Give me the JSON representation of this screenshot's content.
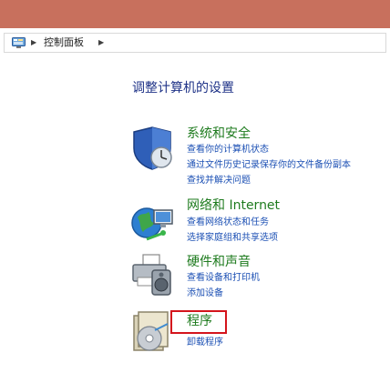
{
  "address_bar": {
    "breadcrumb": "控制面板",
    "icon": "control-panel-icon"
  },
  "page_title": "调整计算机的设置",
  "categories": [
    {
      "title": "系统和安全",
      "icon": "shield-clock-icon",
      "links": [
        "查看你的计算机状态",
        "通过文件历史记录保存你的文件备份副本",
        "查找并解决问题"
      ]
    },
    {
      "title": "网络和 Internet",
      "icon": "globe-network-icon",
      "links": [
        "查看网络状态和任务",
        "选择家庭组和共享选项"
      ]
    },
    {
      "title": "硬件和声音",
      "icon": "printer-speaker-icon",
      "links": [
        "查看设备和打印机",
        "添加设备"
      ]
    },
    {
      "title": "程序",
      "icon": "programs-disc-icon",
      "highlighted": true,
      "links": [
        "卸载程序"
      ]
    }
  ],
  "colors": {
    "title_bar": "#c8705d",
    "category_title": "#1e7b1e",
    "link": "#1c50b4",
    "page_title": "#1e3287",
    "highlight": "#d4141c"
  }
}
